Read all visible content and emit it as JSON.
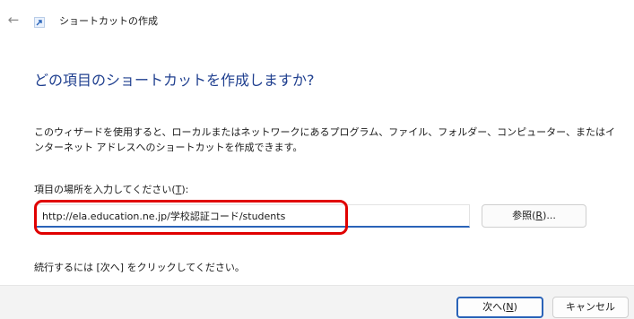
{
  "window": {
    "title": "ショートカットの作成",
    "back_icon": "arrow-left-icon",
    "app_icon": "shortcut-icon"
  },
  "heading": "どの項目のショートカットを作成しますか?",
  "description": "このウィザードを使用すると、ローカルまたはネットワークにあるプログラム、ファイル、フォルダー、コンピューター、またはインターネット アドレスへのショートカットを作成できます。",
  "location": {
    "label_text": "項目の場所を入力してください(",
    "label_mnemonic": "T",
    "label_suffix": "):",
    "value": "http://ela.education.ne.jp/学校認証コード/students"
  },
  "browse_button": {
    "text": "参照(",
    "mnemonic": "R",
    "suffix": ")..."
  },
  "hint": "続行するには [次へ] をクリックしてください。",
  "footer": {
    "next_button": {
      "text": "次へ(",
      "mnemonic": "N",
      "suffix": ")"
    },
    "cancel_button": "キャンセル"
  },
  "colors": {
    "accent": "#2a63b8",
    "heading": "#1f3f8f",
    "highlight": "#e00000",
    "footer_bg": "#f3f3f3"
  }
}
